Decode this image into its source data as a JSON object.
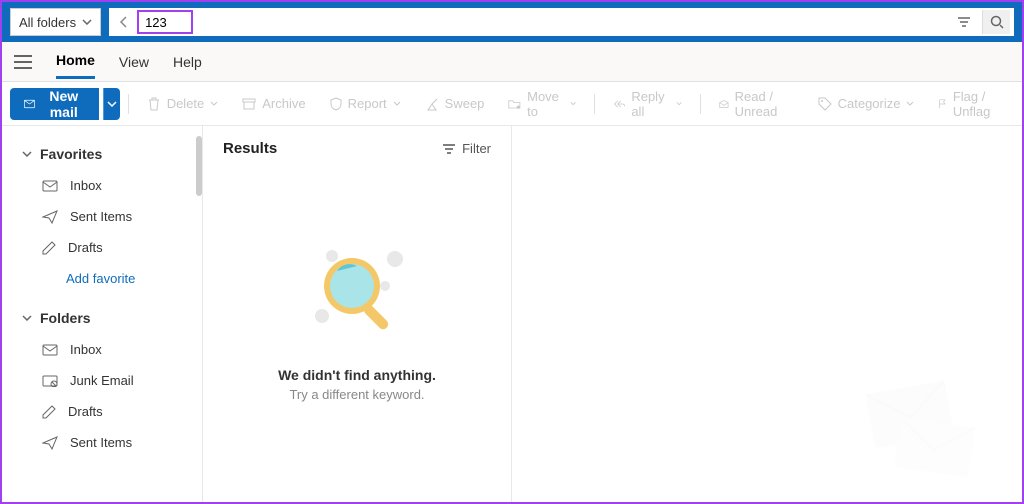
{
  "topbar": {
    "folder_select": "All folders",
    "search_value": "123"
  },
  "menubar": {
    "items": [
      "Home",
      "View",
      "Help"
    ],
    "active_index": 0
  },
  "toolbar": {
    "new_mail": "New mail",
    "delete": "Delete",
    "archive": "Archive",
    "report": "Report",
    "sweep": "Sweep",
    "move_to": "Move to",
    "reply_all": "Reply all",
    "read_unread": "Read / Unread",
    "categorize": "Categorize",
    "flag_unflag": "Flag / Unflag"
  },
  "sidebar": {
    "favorites_label": "Favorites",
    "favorites": [
      {
        "icon": "inbox",
        "label": "Inbox"
      },
      {
        "icon": "sent",
        "label": "Sent Items"
      },
      {
        "icon": "drafts",
        "label": "Drafts"
      }
    ],
    "add_favorite": "Add favorite",
    "folders_label": "Folders",
    "folders": [
      {
        "icon": "inbox",
        "label": "Inbox"
      },
      {
        "icon": "junk",
        "label": "Junk Email"
      },
      {
        "icon": "drafts",
        "label": "Drafts"
      },
      {
        "icon": "sent",
        "label": "Sent Items"
      }
    ]
  },
  "results": {
    "title": "Results",
    "filter": "Filter",
    "empty_title": "We didn't find anything.",
    "empty_subtitle": "Try a different keyword."
  }
}
